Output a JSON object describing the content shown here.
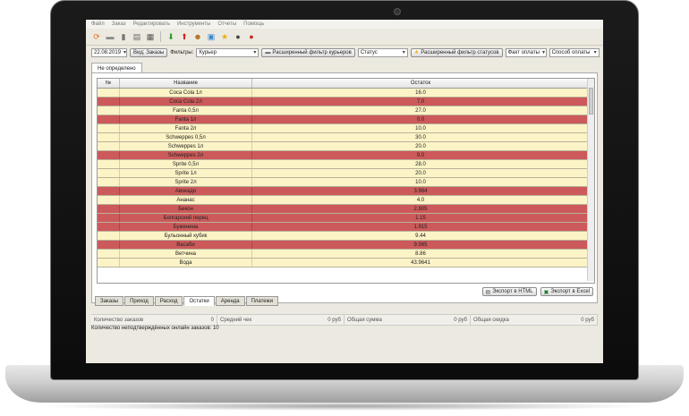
{
  "menu": [
    "Файл",
    "Заказ",
    "Редактировать",
    "Инструменты",
    "Отчеты",
    "Помощь"
  ],
  "toolbar_icons": [
    {
      "name": "refresh-icon",
      "glyph": "⟳",
      "color": "#e07020"
    },
    {
      "name": "car-icon",
      "glyph": "▬",
      "color": "#888"
    },
    {
      "name": "truck-icon",
      "glyph": "▮",
      "color": "#777"
    },
    {
      "name": "print-icon",
      "glyph": "▤",
      "color": "#666"
    },
    {
      "name": "calculator-icon",
      "glyph": "▦",
      "color": "#555"
    },
    {
      "name": "arrow-down-icon",
      "glyph": "⬇",
      "color": "#2a9a2a"
    },
    {
      "name": "arrow-up-icon",
      "glyph": "⬆",
      "color": "#d42020"
    },
    {
      "name": "person-icon",
      "glyph": "☻",
      "color": "#b06a20"
    },
    {
      "name": "image-icon",
      "glyph": "▣",
      "color": "#3a8acc"
    },
    {
      "name": "star-icon",
      "glyph": "★",
      "color": "#e8b010"
    },
    {
      "name": "owl-icon",
      "glyph": "●",
      "color": "#444"
    },
    {
      "name": "stop-icon",
      "glyph": "●",
      "color": "#c83020"
    }
  ],
  "filters": {
    "date": "22.08.2019",
    "view_label": "Вид: Заказы",
    "filter_label": "Фильтры:",
    "courier": "Курьер",
    "courier_filter_button": "Расширенный фильтр курьеров",
    "status": "Статус",
    "status_filter_button": "Расширенный фильтр статусов",
    "payment_fact": "Факт оплаты",
    "payment_method": "Способ оплаты"
  },
  "top_tab": "Не определено",
  "table": {
    "headers": [
      "№",
      "Название",
      "Остаток"
    ],
    "rows": [
      {
        "name": "Coca Cola 1л",
        "value": "16.0",
        "hl": false
      },
      {
        "name": "Coca Cola 2л",
        "value": "7.0",
        "hl": true
      },
      {
        "name": "Fanta 0,5л",
        "value": "27.0",
        "hl": false
      },
      {
        "name": "Fanta 1л",
        "value": "0.0",
        "hl": true
      },
      {
        "name": "Fanta 2л",
        "value": "10.0",
        "hl": false
      },
      {
        "name": "Schweppes 0,5л",
        "value": "30.0",
        "hl": false
      },
      {
        "name": "Schweppes 1л",
        "value": "20.0",
        "hl": false
      },
      {
        "name": "Schweppes 2л",
        "value": "9.0",
        "hl": true
      },
      {
        "name": "Sprite 0,5л",
        "value": "28.0",
        "hl": false
      },
      {
        "name": "Sprite 1л",
        "value": "20.0",
        "hl": false
      },
      {
        "name": "Sprite 2л",
        "value": "10.0",
        "hl": false
      },
      {
        "name": "Авокадо",
        "value": "3.964",
        "hl": true
      },
      {
        "name": "Ананас",
        "value": "4.0",
        "hl": false
      },
      {
        "name": "Бекон",
        "value": "2.805",
        "hl": true
      },
      {
        "name": "Болгарский перец",
        "value": "1.15",
        "hl": true
      },
      {
        "name": "Буженина",
        "value": "1.915",
        "hl": true
      },
      {
        "name": "Бульонный кубик",
        "value": "9.44",
        "hl": false
      },
      {
        "name": "Васаби",
        "value": "9.565",
        "hl": true
      },
      {
        "name": "Ветчина",
        "value": "8.86",
        "hl": false
      },
      {
        "name": "Вода",
        "value": "43.9641",
        "hl": false
      }
    ]
  },
  "export": {
    "html": "Экспорт в HTML",
    "excel": "Экспорт в Excel"
  },
  "bottom_tabs": [
    "Заказы",
    "Приход",
    "Расход",
    "Остатки",
    "Аренда",
    "Платежи"
  ],
  "active_bottom_tab": "Остатки",
  "stats": [
    {
      "label": "Количество заказов",
      "value": "0"
    },
    {
      "label": "Средний чек",
      "value": "0 руб"
    },
    {
      "label": "Общая сумма",
      "value": "0 руб"
    },
    {
      "label": "Общая скидка",
      "value": "0 руб"
    }
  ],
  "unconfirmed": "Количество неподтверждённых онлайн заказов: 10"
}
